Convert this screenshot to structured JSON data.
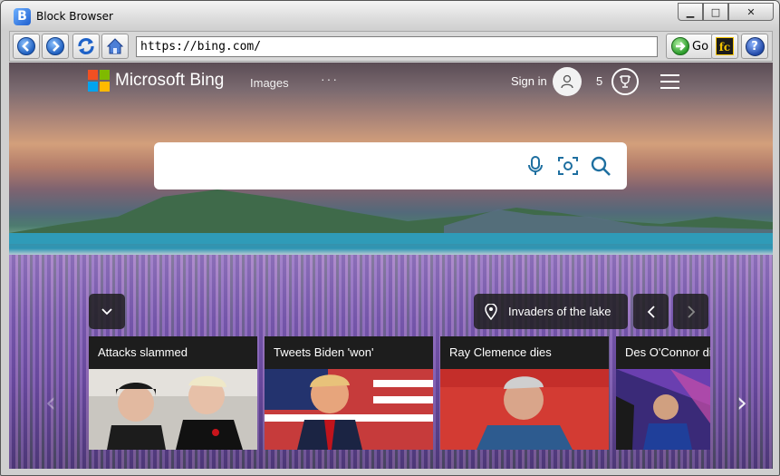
{
  "window": {
    "title": "Block Browser",
    "app_icon_letter": "B",
    "minimize_glyph": "▁",
    "maximize_glyph": "□",
    "close_glyph": "✕"
  },
  "toolbar": {
    "back_icon": "back-arrow-icon",
    "forward_icon": "forward-arrow-icon",
    "refresh_icon": "refresh-icon",
    "home_icon": "home-icon",
    "address": "https://bing.com/",
    "go_label": "Go",
    "fc_label": "fc",
    "help_glyph": "?"
  },
  "bing": {
    "brand": "Microsoft Bing",
    "logo_colors": [
      "#f25022",
      "#7fba00",
      "#00a4ef",
      "#ffb900"
    ],
    "nav_images": "Images",
    "nav_more": "···",
    "sign_in": "Sign in",
    "points": "5",
    "search_accent": "#1e6fa0",
    "location": "Invaders of the lake"
  },
  "news": [
    {
      "headline": "Attacks slammed"
    },
    {
      "headline": "Tweets Biden 'won'"
    },
    {
      "headline": "Ray Clemence dies"
    },
    {
      "headline": "Des O'Connor dies"
    }
  ]
}
